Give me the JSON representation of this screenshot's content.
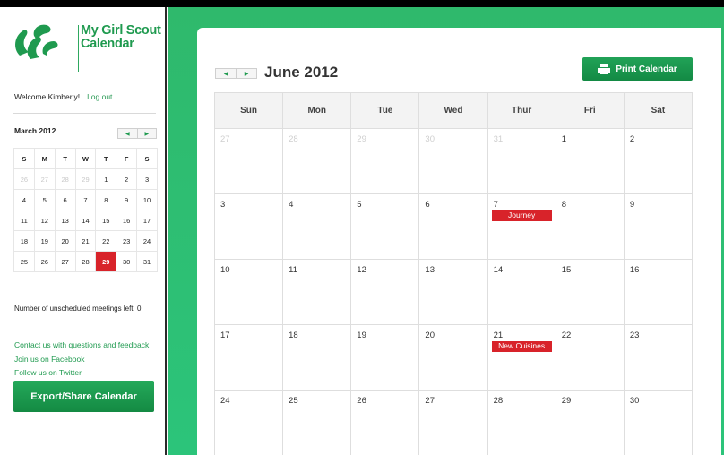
{
  "logo": {
    "text_line1": "My Girl Scout",
    "text_line2": "Calendar"
  },
  "welcome": {
    "text": "Welcome Kimberly!",
    "logout": "Log out"
  },
  "mini_calendar": {
    "title": "March 2012",
    "weekday_headers": [
      "S",
      "M",
      "T",
      "W",
      "T",
      "F",
      "S"
    ],
    "weeks": [
      [
        "26",
        "27",
        "28",
        "29",
        "1",
        "2",
        "3"
      ],
      [
        "4",
        "5",
        "6",
        "7",
        "8",
        "9",
        "10"
      ],
      [
        "11",
        "12",
        "13",
        "14",
        "15",
        "16",
        "17"
      ],
      [
        "18",
        "19",
        "20",
        "21",
        "22",
        "23",
        "24"
      ],
      [
        "25",
        "26",
        "27",
        "28",
        "29",
        "30",
        "31"
      ]
    ],
    "selected_day": "29",
    "prev_icon": "triangle-left-icon",
    "next_icon": "triangle-right-icon"
  },
  "unscheduled": {
    "text": "Number of unscheduled meetings left: 0"
  },
  "links": {
    "contact": "Contact us with questions and feedback",
    "facebook": "Join us on Facebook",
    "twitter": "Follow us on Twitter"
  },
  "export_button": "Export/Share Calendar",
  "calendar": {
    "month_title": "June 2012",
    "print_button": "Print Calendar",
    "print_icon": "printer-icon",
    "weekday_headers": [
      "Sun",
      "Mon",
      "Tue",
      "Wed",
      "Thur",
      "Fri",
      "Sat"
    ],
    "weeks": [
      [
        {
          "day": "27",
          "other": true
        },
        {
          "day": "28",
          "other": true
        },
        {
          "day": "29",
          "other": true
        },
        {
          "day": "30",
          "other": true
        },
        {
          "day": "31",
          "other": true
        },
        {
          "day": "1"
        },
        {
          "day": "2"
        }
      ],
      [
        {
          "day": "3"
        },
        {
          "day": "4"
        },
        {
          "day": "5"
        },
        {
          "day": "6"
        },
        {
          "day": "7",
          "event": "Journey"
        },
        {
          "day": "8"
        },
        {
          "day": "9"
        }
      ],
      [
        {
          "day": "10"
        },
        {
          "day": "11"
        },
        {
          "day": "12"
        },
        {
          "day": "13"
        },
        {
          "day": "14"
        },
        {
          "day": "15"
        },
        {
          "day": "16"
        }
      ],
      [
        {
          "day": "17"
        },
        {
          "day": "18"
        },
        {
          "day": "19"
        },
        {
          "day": "20"
        },
        {
          "day": "21",
          "event": "New Cuisines"
        },
        {
          "day": "22"
        },
        {
          "day": "23"
        }
      ],
      [
        {
          "day": "24"
        },
        {
          "day": "25"
        },
        {
          "day": "26"
        },
        {
          "day": "27"
        },
        {
          "day": "28"
        },
        {
          "day": "29"
        },
        {
          "day": "30"
        }
      ]
    ]
  },
  "colors": {
    "brand_green": "#1f9a4f",
    "event_red": "#d8232a",
    "background_green": "#2fb96c"
  }
}
